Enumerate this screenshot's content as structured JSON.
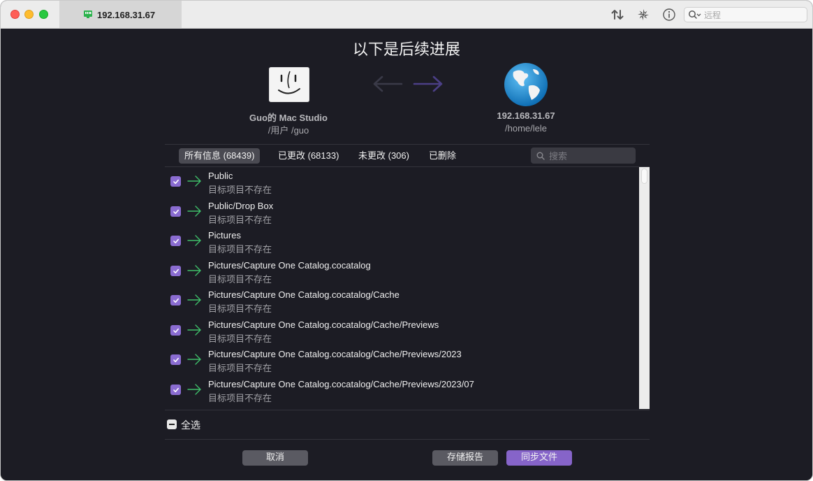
{
  "titlebar": {
    "tab_label": "192.168.31.67",
    "search_placeholder": "远程"
  },
  "heading": "以下是后续进展",
  "source": {
    "name": "Guo的 Mac Studio",
    "path": "/用户 /guo"
  },
  "destination": {
    "name": "192.168.31.67",
    "path": "/home/lele"
  },
  "filters": [
    {
      "label": "所有信息 (68439)",
      "active": true
    },
    {
      "label": "已更改 (68133)",
      "active": false
    },
    {
      "label": "未更改 (306)",
      "active": false
    },
    {
      "label": "已删除",
      "active": false
    }
  ],
  "list_search_placeholder": "搜索",
  "rows": [
    {
      "title": "Public",
      "status": "目标项目不存在",
      "checked": true
    },
    {
      "title": "Public/Drop Box",
      "status": "目标项目不存在",
      "checked": true
    },
    {
      "title": "Pictures",
      "status": "目标项目不存在",
      "checked": true
    },
    {
      "title": "Pictures/Capture One Catalog.cocatalog",
      "status": "目标项目不存在",
      "checked": true
    },
    {
      "title": "Pictures/Capture One Catalog.cocatalog/Cache",
      "status": "目标项目不存在",
      "checked": true
    },
    {
      "title": "Pictures/Capture One Catalog.cocatalog/Cache/Previews",
      "status": "目标项目不存在",
      "checked": true
    },
    {
      "title": "Pictures/Capture One Catalog.cocatalog/Cache/Previews/2023",
      "status": "目标项目不存在",
      "checked": true
    },
    {
      "title": "Pictures/Capture One Catalog.cocatalog/Cache/Previews/2023/07",
      "status": "目标项目不存在",
      "checked": true
    }
  ],
  "select_all_label": "全选",
  "buttons": {
    "cancel": "取消",
    "save_report": "存储报告",
    "sync": "同步文件"
  },
  "colors": {
    "accent": "#8664c9",
    "checkbox": "#8a6cd1",
    "arrow_green": "#3fbf6a",
    "background": "#1c1c24"
  }
}
